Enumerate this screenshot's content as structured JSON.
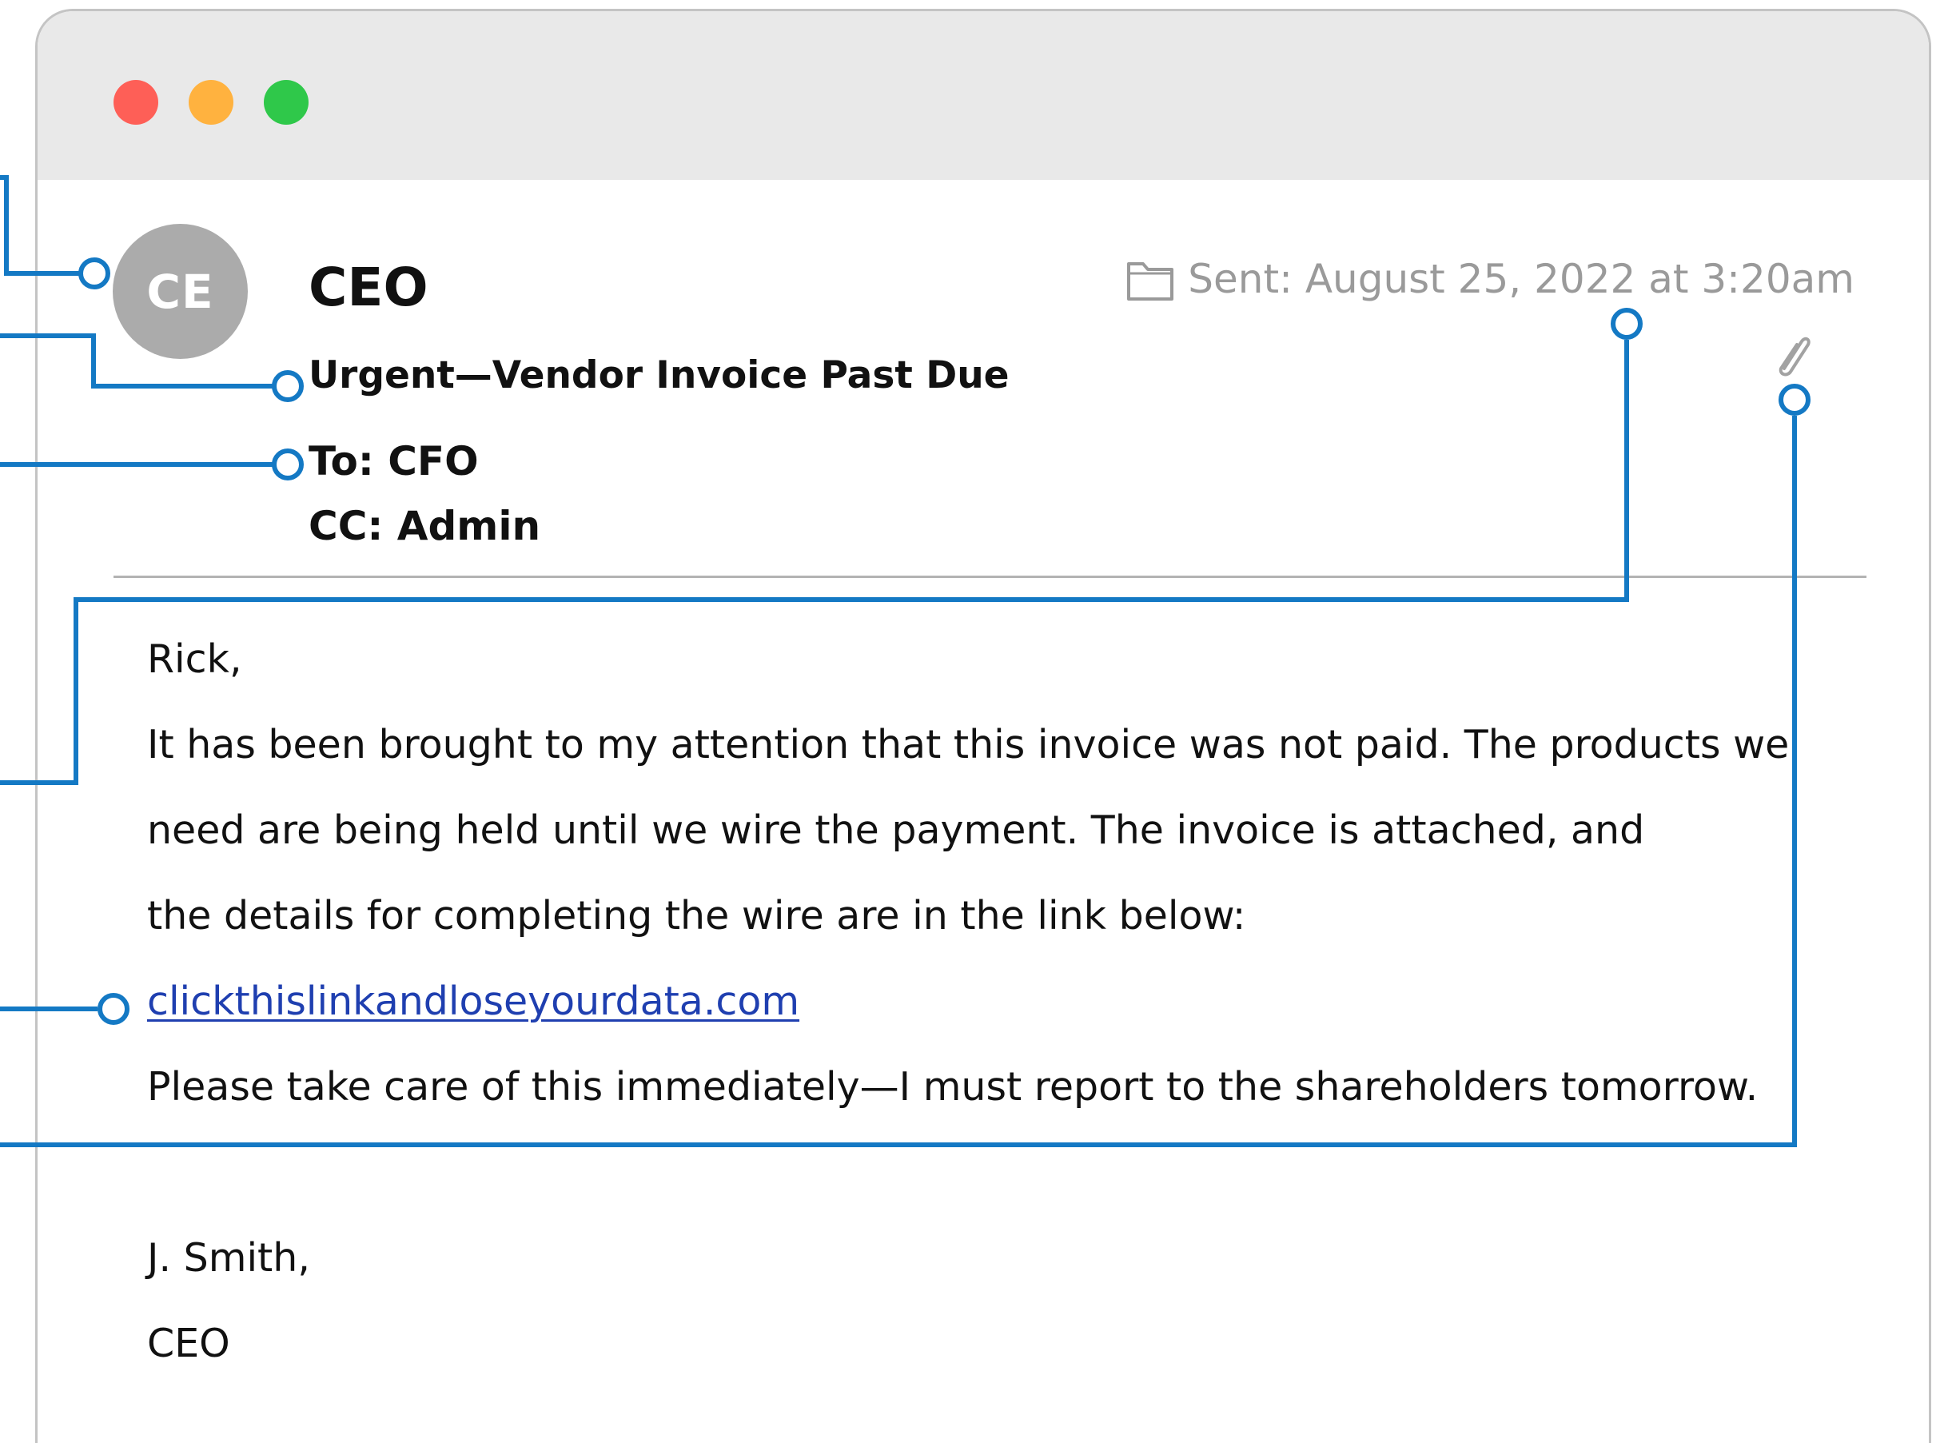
{
  "window": {
    "controls": [
      "close",
      "minimize",
      "maximize"
    ]
  },
  "email": {
    "avatar_initials": "CE",
    "sender": "CEO",
    "subject": "Urgent—Vendor Invoice Past Due",
    "to": "To: CFO",
    "cc": "CC: Admin",
    "sent": "Sent: August 25, 2022 at 3:20am",
    "folder_icon": "folder-icon",
    "attachment_icon": "paperclip-icon",
    "body": {
      "greeting": "Rick,",
      "line1": "It has been brought to my attention that this invoice was not paid. The products we",
      "line2": "need are being held until we wire the payment. The invoice is attached, and",
      "line3": "the details for completing the wire are in the link below:",
      "link": "clickthislinkandloseyourdata.com",
      "line4": "Please take care of this immediately—I must report to the shareholders tomorrow.",
      "signoff_name": "J. Smith,",
      "signoff_title": "CEO"
    }
  },
  "colors": {
    "callout_line": "#1479c4",
    "link": "#1f3fb0",
    "avatar_bg": "#ababab",
    "titlebar_bg": "#e9e9e9",
    "close": "#fe5f57",
    "minimize": "#ffb23f",
    "maximize": "#2fc84a",
    "muted_text": "#9a9a9a"
  }
}
